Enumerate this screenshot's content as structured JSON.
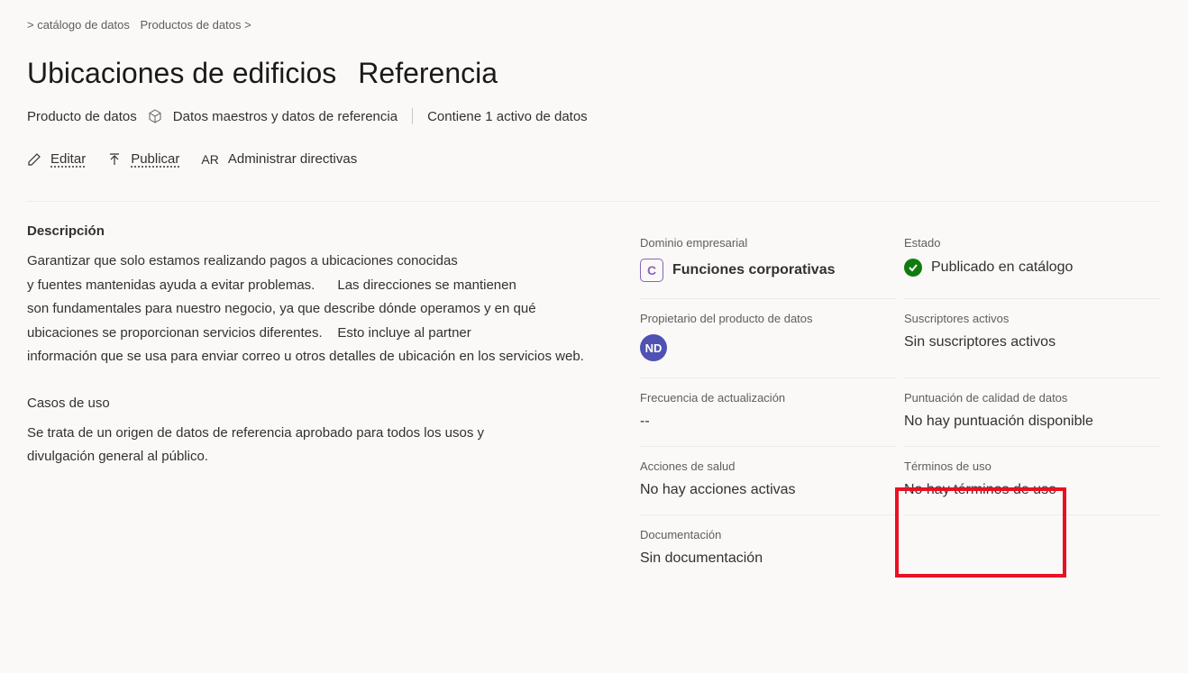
{
  "breadcrumb": {
    "part1": "> catálogo de datos",
    "part2": "Productos de datos >"
  },
  "title": "Ubicaciones de edificios",
  "subtitle": "Referencia",
  "meta": {
    "type": "Producto de datos",
    "category": "Datos maestros y datos de referencia",
    "assets": "Contiene 1 activo de datos"
  },
  "actions": {
    "edit": "Editar",
    "publish": "Publicar",
    "ar": "AR",
    "manage": "Administrar directivas"
  },
  "description": {
    "heading": "Descripción",
    "line1": "Garantizar que solo estamos realizando pagos a ubicaciones conocidas",
    "line2a": "y fuentes mantenidas ayuda a evitar problemas.",
    "line2b": "Las direcciones se mantienen",
    "line3": "son fundamentales para nuestro negocio, ya que describe dónde operamos y en qué",
    "line4a": "ubicaciones se proporcionan servicios diferentes.",
    "line4b": "Esto incluye al partner",
    "line5": "información que se usa para enviar correo u otros detalles de ubicación en los servicios web."
  },
  "usecases": {
    "heading": "Casos de uso",
    "line1": "Se trata de un origen de datos de referencia aprobado para todos los usos y",
    "line2": "divulgación general al público."
  },
  "info": {
    "domain": {
      "label": "Dominio empresarial",
      "badge": "C",
      "value": "Funciones corporativas"
    },
    "status": {
      "label": "Estado",
      "value": "Publicado en catálogo"
    },
    "owner": {
      "label": "Propietario del producto de datos",
      "avatar": "ND"
    },
    "subscribers": {
      "label": "Suscriptores activos",
      "value": "Sin suscriptores activos"
    },
    "frequency": {
      "label": "Frecuencia de actualización",
      "value": "--"
    },
    "quality": {
      "label": "Puntuación de calidad de datos",
      "value": "No hay puntuación disponible"
    },
    "health": {
      "label": "Acciones de salud",
      "value": "No hay acciones activas"
    },
    "terms": {
      "label": "Términos de uso",
      "value": "No hay términos de uso"
    },
    "docs": {
      "label": "Documentación",
      "value": "Sin documentación"
    }
  }
}
